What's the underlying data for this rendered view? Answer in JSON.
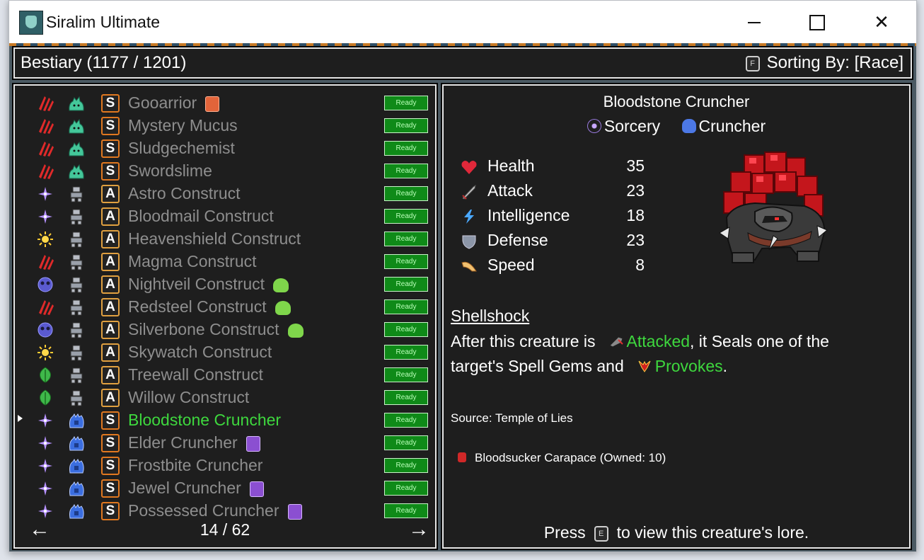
{
  "window": {
    "title": "Siralim Ultimate"
  },
  "header": {
    "title": "Bestiary (1177 / 1201)",
    "sort_key": "F",
    "sort_label": "Sorting By: [Race]"
  },
  "list": {
    "ready_label": "Ready",
    "rows": [
      {
        "name": "Gooarrior",
        "element": "chaos",
        "race": "slime",
        "rank": "S",
        "tag": "card",
        "selected": false
      },
      {
        "name": "Mystery Mucus",
        "element": "chaos",
        "race": "slime",
        "rank": "S",
        "tag": "",
        "selected": false
      },
      {
        "name": "Sludgechemist",
        "element": "chaos",
        "race": "slime",
        "rank": "S",
        "tag": "",
        "selected": false
      },
      {
        "name": "Swordslime",
        "element": "chaos",
        "race": "slime",
        "rank": "S",
        "tag": "",
        "selected": false
      },
      {
        "name": "Astro Construct",
        "element": "sorcery",
        "race": "construct",
        "rank": "A",
        "tag": "",
        "selected": false
      },
      {
        "name": "Bloodmail Construct",
        "element": "sorcery",
        "race": "construct",
        "rank": "A",
        "tag": "",
        "selected": false
      },
      {
        "name": "Heavenshield Construct",
        "element": "life",
        "race": "construct",
        "rank": "A",
        "tag": "",
        "selected": false
      },
      {
        "name": "Magma Construct",
        "element": "chaos",
        "race": "construct",
        "rank": "A",
        "tag": "",
        "selected": false
      },
      {
        "name": "Nightveil Construct",
        "element": "death",
        "race": "construct",
        "rank": "A",
        "tag": "slime",
        "selected": false
      },
      {
        "name": "Redsteel Construct",
        "element": "chaos",
        "race": "construct",
        "rank": "A",
        "tag": "slime",
        "selected": false
      },
      {
        "name": "Silverbone Construct",
        "element": "death",
        "race": "construct",
        "rank": "A",
        "tag": "slime",
        "selected": false
      },
      {
        "name": "Skywatch Construct",
        "element": "life",
        "race": "construct",
        "rank": "A",
        "tag": "",
        "selected": false
      },
      {
        "name": "Treewall Construct",
        "element": "nature",
        "race": "construct",
        "rank": "A",
        "tag": "",
        "selected": false
      },
      {
        "name": "Willow Construct",
        "element": "nature",
        "race": "construct",
        "rank": "A",
        "tag": "",
        "selected": false
      },
      {
        "name": "Bloodstone Cruncher",
        "element": "sorcery",
        "race": "cruncher",
        "rank": "S",
        "tag": "",
        "selected": true
      },
      {
        "name": "Elder Cruncher",
        "element": "sorcery",
        "race": "cruncher",
        "rank": "S",
        "tag": "gem",
        "selected": false
      },
      {
        "name": "Frostbite Cruncher",
        "element": "sorcery",
        "race": "cruncher",
        "rank": "S",
        "tag": "",
        "selected": false
      },
      {
        "name": "Jewel Cruncher",
        "element": "sorcery",
        "race": "cruncher",
        "rank": "S",
        "tag": "gem",
        "selected": false
      },
      {
        "name": "Possessed Cruncher",
        "element": "sorcery",
        "race": "cruncher",
        "rank": "S",
        "tag": "gem",
        "selected": false
      }
    ],
    "page": "14 / 62",
    "prev_arrow": "←",
    "next_arrow": "→"
  },
  "detail": {
    "name": "Bloodstone Cruncher",
    "class": "Sorcery",
    "race": "Cruncher",
    "stats": [
      {
        "label": "Health",
        "value": "35",
        "icon": "heart-icon",
        "color": "#e0283a"
      },
      {
        "label": "Attack",
        "value": "23",
        "icon": "sword-icon",
        "color": "#c8c8c8"
      },
      {
        "label": "Intelligence",
        "value": "18",
        "icon": "lightning-icon",
        "color": "#4aa8ff"
      },
      {
        "label": "Defense",
        "value": "23",
        "icon": "shield-icon",
        "color": "#8c96a8"
      },
      {
        "label": "Speed",
        "value": "8",
        "icon": "wing-icon",
        "color": "#f0c070"
      }
    ],
    "ability_name": "Shellshock",
    "desc_line1_a": "After this creature is",
    "desc_attacked": "Attacked",
    "desc_line1_b": ", it Seals one of the",
    "desc_line2_a": "target's Spell Gems and",
    "desc_provokes": "Provokes",
    "desc_line2_b": ".",
    "source": "Source: Temple of Lies",
    "material": "Bloodsucker Carapace (Owned: 10)",
    "lore_press": "Press",
    "lore_key": "E",
    "lore_rest": "to view this creature's lore."
  }
}
